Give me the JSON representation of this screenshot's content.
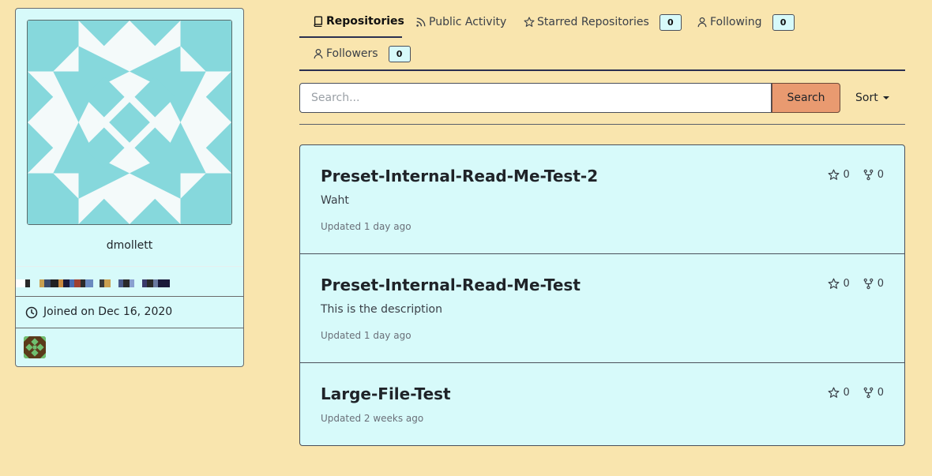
{
  "profile": {
    "username": "dmollett",
    "joined": "Joined on Dec 16, 2020"
  },
  "tabs": [
    {
      "label": "Repositories",
      "icon": "repo-icon",
      "active": true
    },
    {
      "label": "Public Activity",
      "icon": "rss-icon"
    },
    {
      "label": "Starred Repositories",
      "icon": "star-icon",
      "count": "0"
    },
    {
      "label": "Following",
      "icon": "person-icon",
      "count": "0"
    },
    {
      "label": "Followers",
      "icon": "person-icon",
      "count": "0"
    }
  ],
  "search": {
    "placeholder": "Search...",
    "button": "Search",
    "sort": "Sort"
  },
  "repos": [
    {
      "name": "Preset-Internal-Read-Me-Test-2",
      "description": "Waht",
      "updated": "Updated 1 day ago",
      "stars": "0",
      "forks": "0"
    },
    {
      "name": "Preset-Internal-Read-Me-Test",
      "description": "This is the description",
      "updated": "Updated 1 day ago",
      "stars": "0",
      "forks": "0"
    },
    {
      "name": "Large-File-Test",
      "description": "",
      "updated": "Updated 2 weeks ago",
      "stars": "0",
      "forks": "0"
    }
  ],
  "colors": {
    "background": "#f9e5ae",
    "card": "#d7fafa",
    "accent_button": "#e99a70",
    "identicon": "#86d8dc"
  }
}
